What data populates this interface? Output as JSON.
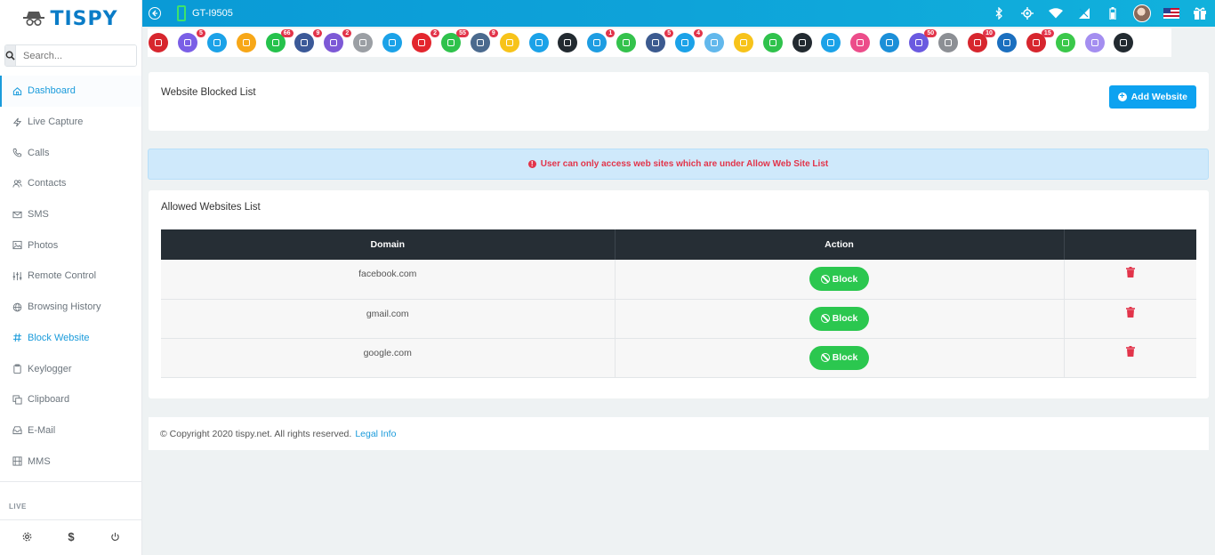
{
  "brand": {
    "name": "TISPY"
  },
  "search": {
    "placeholder": "Search..."
  },
  "sidebar": {
    "items": [
      {
        "label": "Dashboard",
        "icon": "home-icon",
        "active": true
      },
      {
        "label": "Live Capture",
        "icon": "bolt-icon"
      },
      {
        "label": "Calls",
        "icon": "phone-icon"
      },
      {
        "label": "Contacts",
        "icon": "users-icon"
      },
      {
        "label": "SMS",
        "icon": "mail-icon"
      },
      {
        "label": "Photos",
        "icon": "image-icon"
      },
      {
        "label": "Remote Control",
        "icon": "sliders-icon"
      },
      {
        "label": "Browsing History",
        "icon": "globe-icon"
      },
      {
        "label": "Block Website",
        "icon": "hash-icon",
        "active": true
      },
      {
        "label": "Keylogger",
        "icon": "clipboard-icon"
      },
      {
        "label": "Clipboard",
        "icon": "copy-icon"
      },
      {
        "label": "E-Mail",
        "icon": "inbox-icon"
      },
      {
        "label": "MMS",
        "icon": "film-icon"
      }
    ],
    "live_label": "LIVE",
    "footer_dollar": "$"
  },
  "topbar": {
    "device_name": "GT-I9505"
  },
  "apps": [
    {
      "name": "screen-recorder-icon",
      "color": "#d7262e",
      "badge": ""
    },
    {
      "name": "calls-app-icon",
      "color": "#7a5fe6",
      "badge": "5"
    },
    {
      "name": "email-app-icon",
      "color": "#1ba2e8",
      "badge": ""
    },
    {
      "name": "files-app-icon",
      "color": "#f7a718",
      "badge": ""
    },
    {
      "name": "whatsapp-icon",
      "color": "#25c24c",
      "badge": "66"
    },
    {
      "name": "facebook-icon",
      "color": "#3b5998",
      "badge": "9"
    },
    {
      "name": "viber-icon",
      "color": "#7d59d6",
      "badge": "2"
    },
    {
      "name": "clipboard-app-icon",
      "color": "#9b9fa4",
      "badge": ""
    },
    {
      "name": "screen-app-icon",
      "color": "#1ba2e8",
      "badge": ""
    },
    {
      "name": "tinder-icon",
      "color": "#e3262e",
      "badge": "2"
    },
    {
      "name": "wechat-icon",
      "color": "#2fc24c",
      "badge": "55"
    },
    {
      "name": "instagram-icon",
      "color": "#4b6a8e",
      "badge": "9"
    },
    {
      "name": "snapchat-icon",
      "color": "#f7c31a",
      "badge": ""
    },
    {
      "name": "flickr-icon",
      "color": "#1ba2e8",
      "badge": ""
    },
    {
      "name": "tiktok-icon",
      "color": "#222a30",
      "badge": ""
    },
    {
      "name": "telegram-icon",
      "color": "#1e9de2",
      "badge": "1"
    },
    {
      "name": "line-icon",
      "color": "#34c24c",
      "badge": ""
    },
    {
      "name": "messenger-icon",
      "color": "#3c5a8f",
      "badge": "5"
    },
    {
      "name": "skype-icon",
      "color": "#1ba2e8",
      "badge": "4"
    },
    {
      "name": "bip-icon",
      "color": "#62b8ec",
      "badge": ""
    },
    {
      "name": "talk-icon",
      "color": "#f7c31a",
      "badge": ""
    },
    {
      "name": "hangouts-icon",
      "color": "#2fc24c",
      "badge": ""
    },
    {
      "name": "kik-icon",
      "color": "#222a30",
      "badge": ""
    },
    {
      "name": "imo-icon",
      "color": "#1ba2e8",
      "badge": ""
    },
    {
      "name": "video-app-icon",
      "color": "#ec4d8a",
      "badge": ""
    },
    {
      "name": "hike-icon",
      "color": "#1b8fd8",
      "badge": ""
    },
    {
      "name": "signal-icon",
      "color": "#6a5ae0",
      "badge": "50"
    },
    {
      "name": "zoom-icon",
      "color": "#8c8f94",
      "badge": ""
    },
    {
      "name": "gallery-icon",
      "color": "#d7262e",
      "badge": "10"
    },
    {
      "name": "device-app-icon",
      "color": "#1b6fbf",
      "badge": ""
    },
    {
      "name": "browser-icon",
      "color": "#d7262e",
      "badge": "15"
    },
    {
      "name": "download-icon",
      "color": "#3ac84a",
      "badge": ""
    },
    {
      "name": "location-icon",
      "color": "#a48ef0",
      "badge": ""
    },
    {
      "name": "help-icon",
      "color": "#222a30",
      "badge": ""
    }
  ],
  "blocked_card": {
    "title": "Website Blocked List",
    "add_button": "Add Website"
  },
  "alert": {
    "text": "User can only access web sites which are under Allow Web Site List"
  },
  "allowed_card": {
    "title": "Allowed Websites List",
    "columns": [
      "Domain",
      "Action",
      ""
    ],
    "rows": [
      {
        "domain": "facebook.com",
        "action": "Block"
      },
      {
        "domain": "gmail.com",
        "action": "Block"
      },
      {
        "domain": "google.com",
        "action": "Block"
      }
    ]
  },
  "footer": {
    "copyright": "© Copyright 2020 tispy.net. All rights reserved.",
    "legal_link": "Legal Info"
  }
}
